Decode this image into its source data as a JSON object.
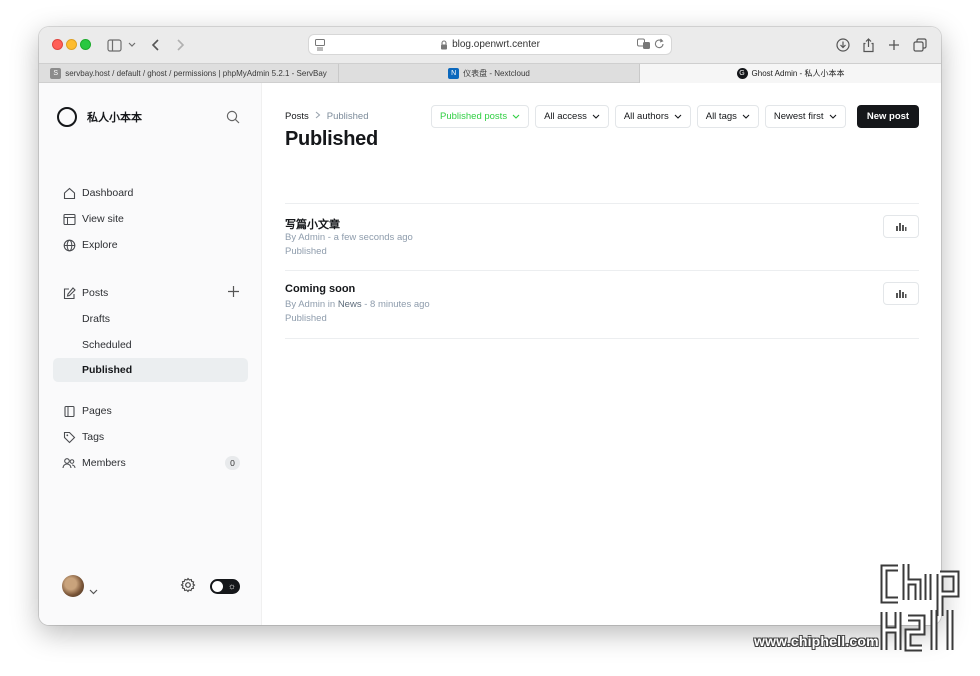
{
  "browser": {
    "url": "blog.openwrt.center",
    "tabs": [
      {
        "favicon": "S",
        "favicon_color": "#8c8c8c",
        "label": "servbay.host / default / ghost / permissions | phpMyAdmin 5.2.1 - ServBay"
      },
      {
        "favicon": "N",
        "favicon_color": "#0b68bd",
        "label": "仪表盘 - Nextcloud"
      },
      {
        "favicon": "G",
        "favicon_color": "#15171a",
        "label": "Ghost Admin - 私人小本本"
      }
    ]
  },
  "sidebar": {
    "site_name": "私人小本本",
    "items": [
      {
        "label": "Dashboard",
        "icon": "home-icon"
      },
      {
        "label": "View site",
        "icon": "browser-icon"
      },
      {
        "label": "Explore",
        "icon": "globe-icon"
      },
      {
        "label": "Posts",
        "icon": "edit-icon"
      },
      {
        "label": "Drafts"
      },
      {
        "label": "Scheduled"
      },
      {
        "label": "Published"
      },
      {
        "label": "Pages",
        "icon": "page-icon"
      },
      {
        "label": "Tags",
        "icon": "tag-icon"
      },
      {
        "label": "Members",
        "icon": "members-icon",
        "count": "0"
      }
    ]
  },
  "main": {
    "breadcrumb": {
      "parent": "Posts",
      "current": "Published"
    },
    "title": "Published",
    "filters": [
      "Published posts",
      "All access",
      "All authors",
      "All tags",
      "Newest first"
    ],
    "new_post_label": "New post",
    "posts": [
      {
        "title": "写篇小文章",
        "meta_prefix": "By Admin - a few seconds ago",
        "status": "Published"
      },
      {
        "title": "Coming soon",
        "meta_by": "By Admin in ",
        "meta_tag": "News",
        "meta_time": " - 8 minutes ago",
        "status": "Published"
      }
    ]
  },
  "watermark": {
    "text": "www.chiphell.com"
  },
  "colors": {
    "accent_green": "#30cf43",
    "dark": "#15171a"
  }
}
